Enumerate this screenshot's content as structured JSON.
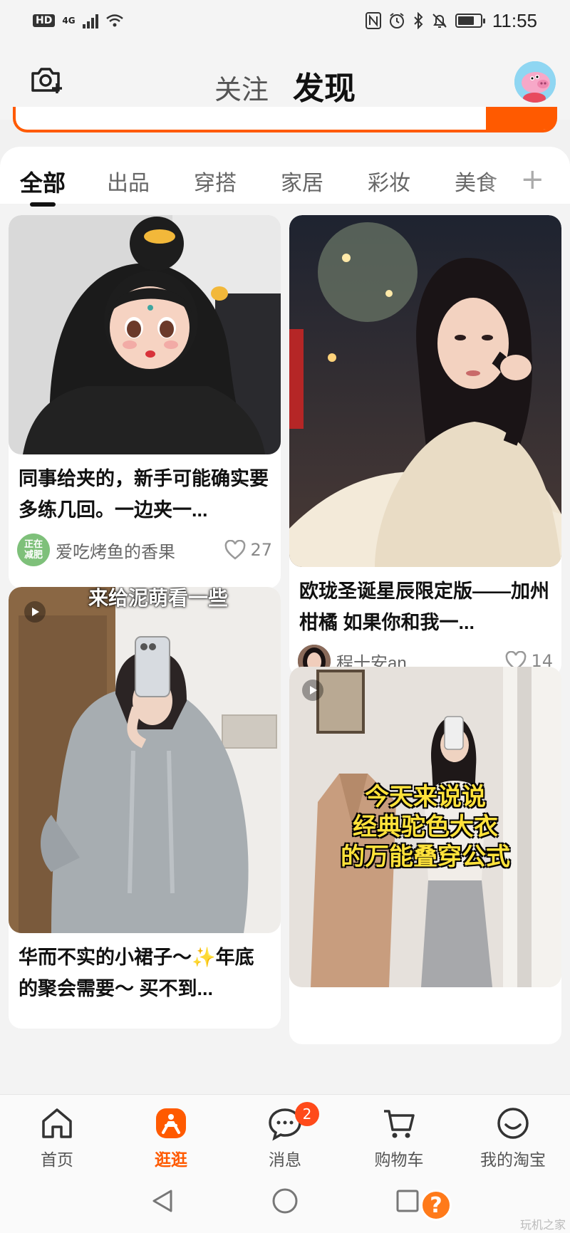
{
  "status_bar": {
    "hd": "HD",
    "network": "4G",
    "time": "11:55",
    "battery_level": 0.75
  },
  "header": {
    "tabs": [
      {
        "label": "关注",
        "active": false
      },
      {
        "label": "发现",
        "active": true
      }
    ]
  },
  "categories": {
    "items": [
      "全部",
      "出品",
      "穿搭",
      "家居",
      "彩妆",
      "美食"
    ],
    "active_index": 0,
    "add_icon": "plus-icon"
  },
  "feed": {
    "cards": [
      {
        "title": "同事给夹的，新手可能确实要多练几回。一边夹一...",
        "author": "爱吃烤鱼的香果",
        "author_badge": "正在减肥",
        "likes": "27"
      },
      {
        "title": "欧珑圣诞星辰限定版——加州柑橘 如果你和我一...",
        "author": "程十安an",
        "likes": "14"
      },
      {
        "title": "华而不实的小裙子～✨年底的聚会需要～ 买不到...",
        "overlay_text": "来给泥萌看一些",
        "author": "",
        "likes": ""
      },
      {
        "overlay_text_lines": [
          "今天来说说",
          "经典驼色大衣",
          "的万能叠穿公式"
        ]
      }
    ]
  },
  "bottom_nav": {
    "items": [
      {
        "label": "首页",
        "icon": "home-icon",
        "active": false
      },
      {
        "label": "逛逛",
        "icon": "browse-icon",
        "active": true
      },
      {
        "label": "消息",
        "icon": "message-icon",
        "active": false,
        "badge": "2"
      },
      {
        "label": "购物车",
        "icon": "cart-icon",
        "active": false
      },
      {
        "label": "我的淘宝",
        "icon": "profile-icon",
        "active": false
      }
    ]
  },
  "system_nav": {
    "help": "?",
    "watermark": "玩机之家"
  },
  "colors": {
    "accent": "#ff5a00",
    "badge": "#ff4a1a"
  }
}
